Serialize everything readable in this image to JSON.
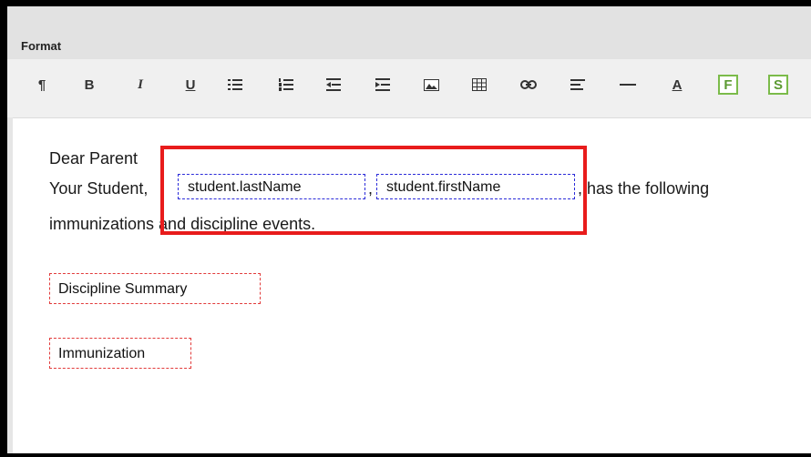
{
  "header": {
    "format_label": "Format"
  },
  "toolbar": {
    "buttons": [
      {
        "name": "paragraph-icon",
        "glyph": "¶"
      },
      {
        "name": "bold-icon",
        "glyph": "B"
      },
      {
        "name": "italic-icon",
        "glyph": "I"
      },
      {
        "name": "underline-icon",
        "glyph": "U"
      },
      {
        "name": "bulleted-list-icon"
      },
      {
        "name": "numbered-list-icon"
      },
      {
        "name": "outdent-icon"
      },
      {
        "name": "indent-icon"
      },
      {
        "name": "image-icon"
      },
      {
        "name": "table-icon"
      },
      {
        "name": "link-icon"
      },
      {
        "name": "align-icon"
      },
      {
        "name": "horizontal-rule-icon"
      },
      {
        "name": "text-color-icon",
        "glyph": "A"
      },
      {
        "name": "field-icon",
        "glyph": "F"
      },
      {
        "name": "subreport-icon",
        "glyph": "S"
      }
    ],
    "accent_color": "#7bbb4a"
  },
  "editor": {
    "greeting": "Dear Parent",
    "line2_prefix": "Your Student",
    "comma1": ",",
    "comma2": ",",
    "comma3": ",",
    "line2_suffix": "has the following",
    "line3": "immunizations and discipline events.",
    "field_last_name": "student.lastName",
    "field_first_name": "student.firstName",
    "discipline_summary": "Discipline Summary",
    "immunization": "Immunization"
  },
  "colors": {
    "highlight": "#e81c1c",
    "field_border_blue": "#2b2bd9",
    "field_border_red": "#e23b3b"
  }
}
